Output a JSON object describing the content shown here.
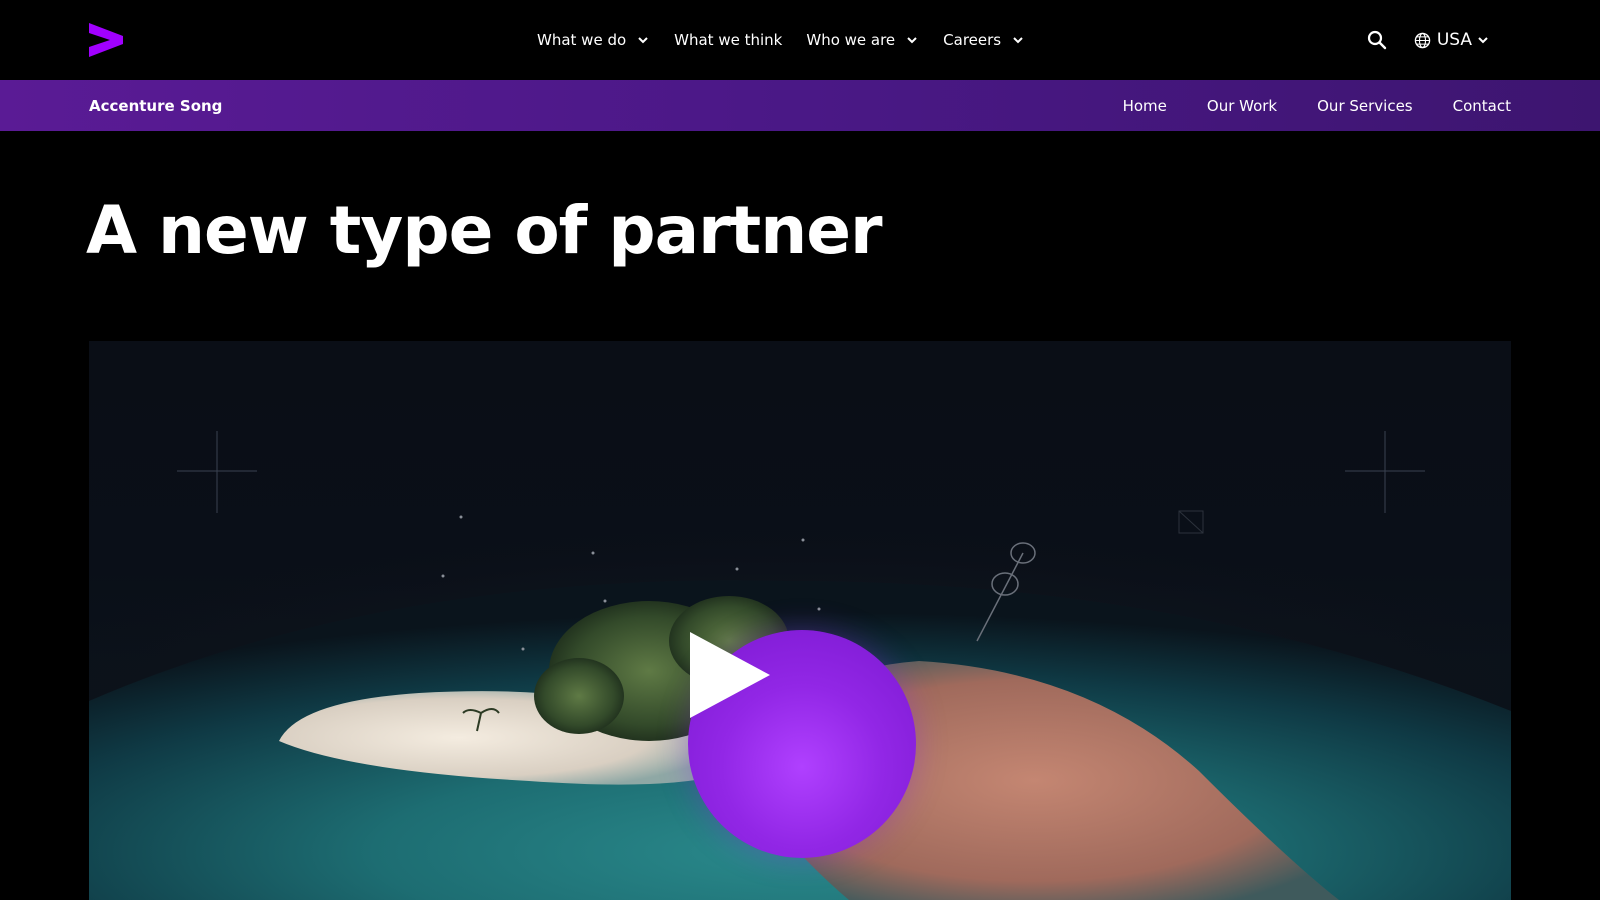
{
  "top_nav": {
    "logo_icon": "accenture-greater-than-logo",
    "items": [
      {
        "label": "What we do",
        "has_dropdown": true
      },
      {
        "label": "What we think",
        "has_dropdown": false
      },
      {
        "label": "Who we are",
        "has_dropdown": true
      },
      {
        "label": "Careers",
        "has_dropdown": true
      }
    ],
    "search_icon": "search-icon",
    "locale": {
      "label": "USA",
      "icon": "globe-icon"
    }
  },
  "sub_nav": {
    "brand": "Accenture Song",
    "links": [
      "Home",
      "Our Work",
      "Our Services",
      "Contact"
    ]
  },
  "hero": {
    "title": "A new type of partner"
  },
  "video": {
    "play_icon": "play-icon"
  },
  "colors": {
    "accent": "#a100ff",
    "subnav_bg": "#4d1a7f",
    "page_bg": "#000000"
  }
}
